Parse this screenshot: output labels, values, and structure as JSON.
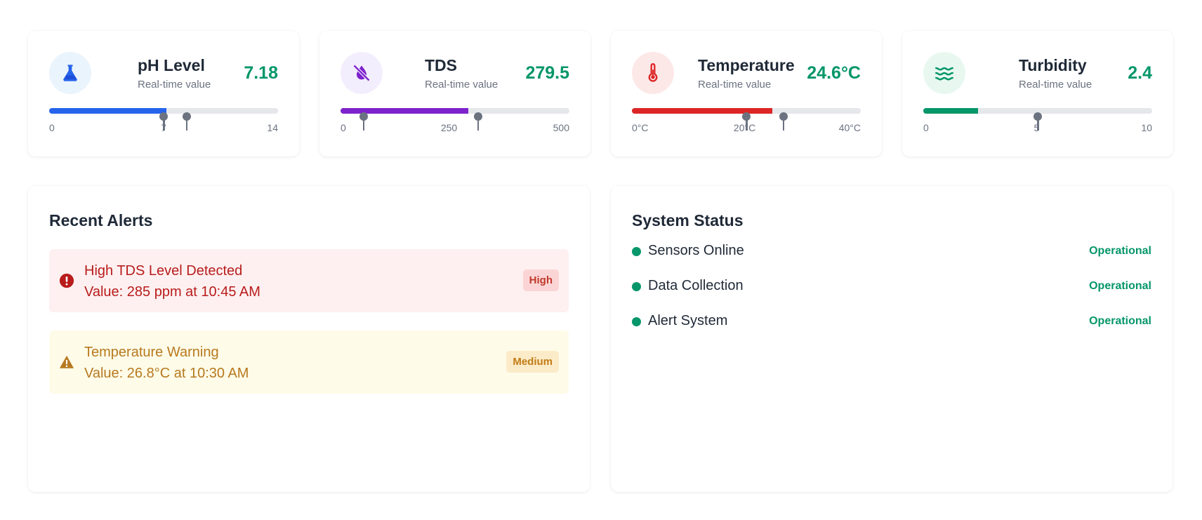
{
  "metrics": [
    {
      "title": "pH Level",
      "subtitle": "Real-time value",
      "value": "7.18",
      "icon": "flask-icon",
      "colors": {
        "accent": "#2563eb",
        "icon_bg": "#eaf4fd"
      },
      "ticks": {
        "min": "0",
        "mid": "7",
        "max": "14"
      },
      "range": [
        0,
        14
      ],
      "current": 7.18,
      "markers": [
        7,
        8.4
      ],
      "mid_value": 7
    },
    {
      "title": "TDS",
      "subtitle": "Real-time value",
      "value": "279.5",
      "icon": "eye-slash-icon",
      "colors": {
        "accent": "#7e22ce",
        "icon_bg": "#f3eefd"
      },
      "ticks": {
        "min": "0",
        "mid": "250",
        "max": "500"
      },
      "range": [
        0,
        500
      ],
      "current": 279.5,
      "markers": [
        50,
        300
      ],
      "mid_value": 237
    },
    {
      "title": "Temperature",
      "subtitle": "Real-time value",
      "value": "24.6°C",
      "icon": "thermometer-icon",
      "colors": {
        "accent": "#dc2626",
        "icon_bg": "#fde8e8"
      },
      "ticks": {
        "min": "0°C",
        "mid": "20°C",
        "max": "40°C"
      },
      "range": [
        0,
        40
      ],
      "current": 24.6,
      "markers": [
        20,
        26.5
      ],
      "mid_value": 19.7
    },
    {
      "title": "Turbidity",
      "subtitle": "Real-time value",
      "value": "2.4",
      "icon": "water-waves-icon",
      "colors": {
        "accent": "#059669",
        "icon_bg": "#e8f8f1"
      },
      "ticks": {
        "min": "0",
        "mid": "5",
        "max": "10"
      },
      "range": [
        0,
        10
      ],
      "current": 2.4,
      "markers": [
        5
      ],
      "mid_value": 4.95
    }
  ],
  "alerts": {
    "heading": "Recent Alerts",
    "items": [
      {
        "title": "High TDS Level Detected",
        "detail": "Value: 285 ppm at 10:45 AM",
        "severity": "High",
        "icon": "exclamation-circle-icon"
      },
      {
        "title": "Temperature Warning",
        "detail": "Value: 26.8°C at 10:30 AM",
        "severity": "Medium",
        "icon": "warning-triangle-icon"
      }
    ]
  },
  "system_status": {
    "heading": "System Status",
    "items": [
      {
        "label": "Sensors Online",
        "state": "Operational"
      },
      {
        "label": "Data Collection",
        "state": "Operational"
      },
      {
        "label": "Alert System",
        "state": "Operational"
      }
    ],
    "status_color": "#059669"
  }
}
